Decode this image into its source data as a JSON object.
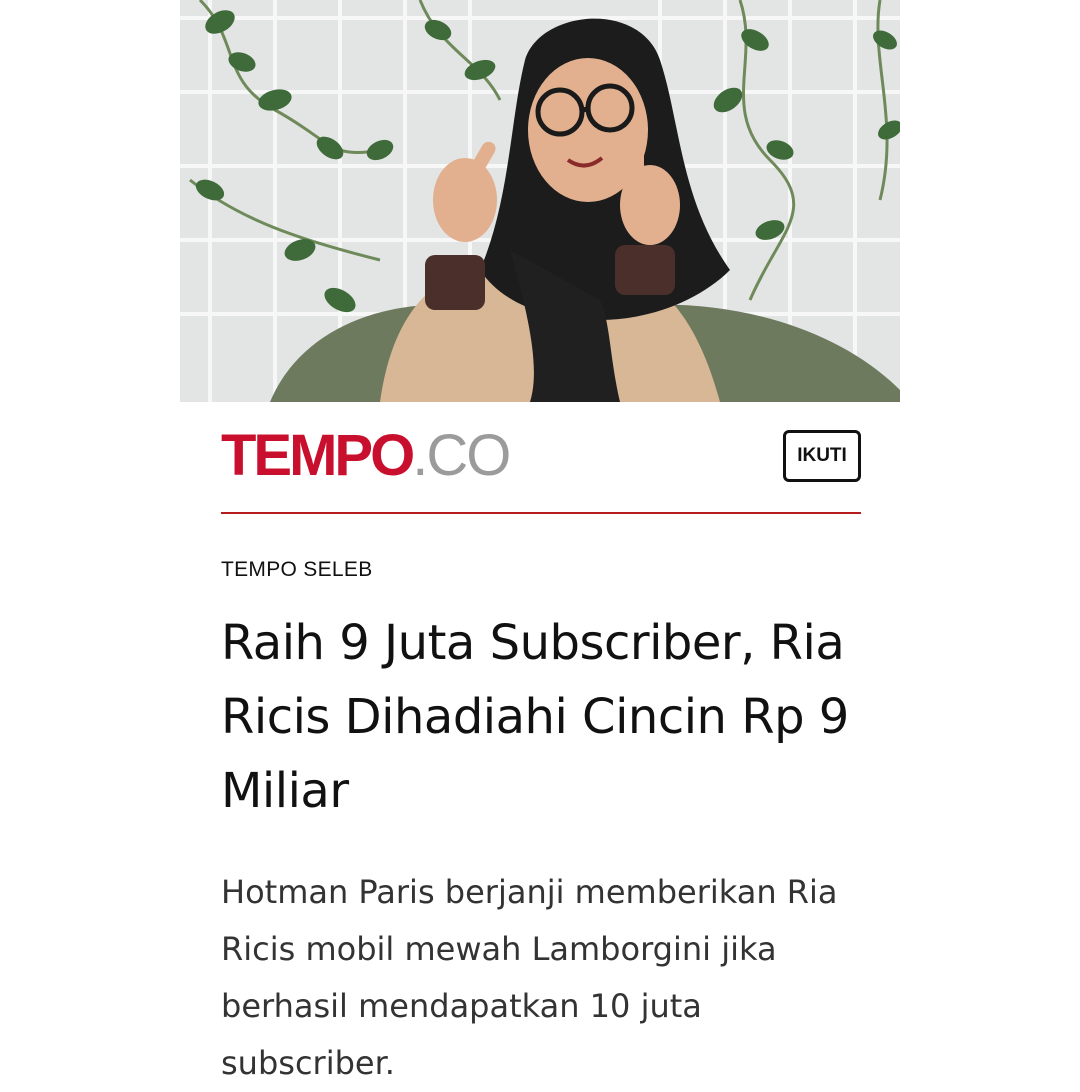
{
  "article": {
    "hero_image_alt": "Ria Ricis",
    "publisher": {
      "logo_main": "TEMPO",
      "logo_suffix": ".CO",
      "brand_color": "#c8102e",
      "suffix_color": "#9b9b9b"
    },
    "follow_label": "IKUTI",
    "divider_color": "#b71c1c",
    "category": "TEMPO SELEB",
    "title": "Raih 9 Juta Subscriber, Ria Ricis Dihadiahi Cincin Rp 9 Miliar",
    "summary": "Hotman Paris berjanji memberikan Ria Ricis mobil mewah Lamborgini jika berhasil mendapatkan 10 juta subscriber."
  }
}
